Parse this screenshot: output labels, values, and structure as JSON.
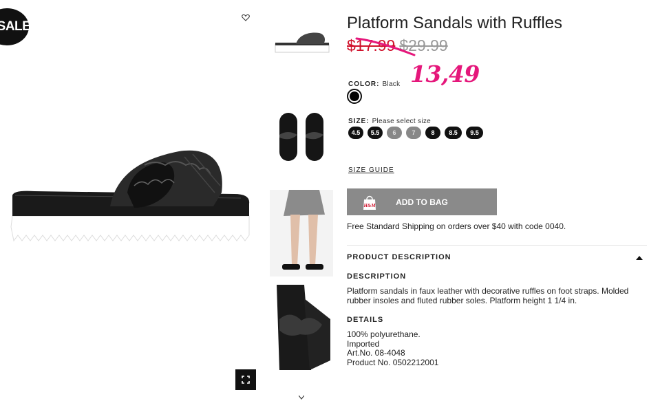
{
  "badge": {
    "sale": "SALE"
  },
  "product": {
    "title": "Platform Sandals with Ruffles",
    "price_sale": "$17.99",
    "price_original": "$29.99",
    "handwritten_price": "13,49",
    "color_label": "COLOR:",
    "color_value": "Black",
    "size_label": "SIZE:",
    "size_hint": "Please select size",
    "sizes": [
      "4.5",
      "5.5",
      "6",
      "7",
      "8",
      "8.5",
      "9.5"
    ],
    "size_guide": "SIZE GUIDE",
    "add_to_bag": "ADD TO BAG",
    "bag_logo": "H&M",
    "shipping": "Free Standard Shipping on orders over $40 with code 0040.",
    "product_description_header": "PRODUCT DESCRIPTION",
    "description_title": "DESCRIPTION",
    "description": "Platform sandals in faux leather with decorative ruffles on foot straps. Molded rubber insoles and fluted rubber soles. Platform height 1 1/4 in.",
    "details_title": "DETAILS",
    "details": [
      "100% polyurethane.",
      "Imported",
      "Art.No. 08-4048",
      "Product No. 0502212001"
    ]
  },
  "colors": {
    "sale_red": "#d0112b",
    "handwritten_pink": "#e5177b",
    "button_gray": "#8a8a8a",
    "swatch_black": "#000000"
  },
  "icons": [
    "heart-icon",
    "fullscreen-icon",
    "shopping-bag-icon",
    "caret-up-icon",
    "caret-down-icon"
  ]
}
